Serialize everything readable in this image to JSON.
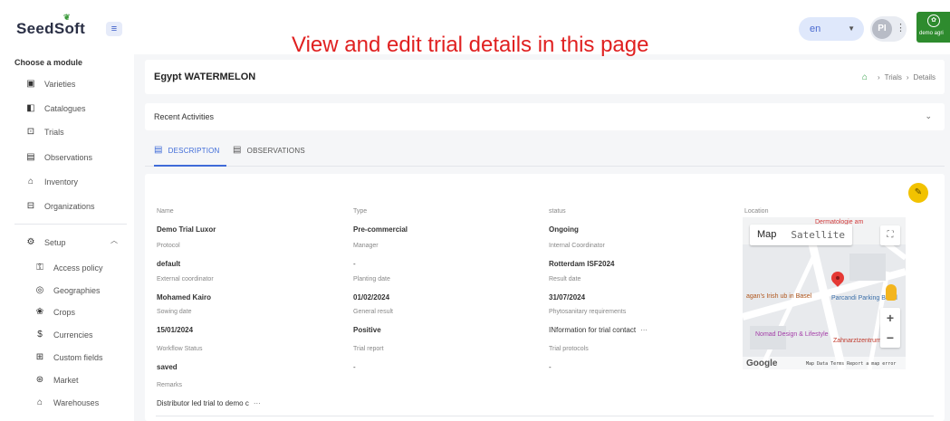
{
  "app": {
    "logo": "SeedSoft",
    "banner": "View and edit trial details in this page"
  },
  "header": {
    "language": "en",
    "avatar_initials": "PI",
    "org_name": "demo agri"
  },
  "sidebar": {
    "title": "Choose a module",
    "items": [
      {
        "label": "Varieties",
        "icon": "varieties-icon"
      },
      {
        "label": "Catalogues",
        "icon": "catalogue-icon"
      },
      {
        "label": "Trials",
        "icon": "trials-icon"
      },
      {
        "label": "Observations",
        "icon": "observations-icon"
      },
      {
        "label": "Inventory",
        "icon": "inventory-icon"
      },
      {
        "label": "Organizations",
        "icon": "organizations-icon"
      }
    ],
    "setup": {
      "label": "Setup",
      "items": [
        {
          "label": "Access policy",
          "icon": "access-policy-icon"
        },
        {
          "label": "Geographies",
          "icon": "geographies-icon"
        },
        {
          "label": "Crops",
          "icon": "crops-icon"
        },
        {
          "label": "Currencies",
          "icon": "currencies-icon"
        },
        {
          "label": "Custom fields",
          "icon": "custom-fields-icon"
        },
        {
          "label": "Market",
          "icon": "market-icon"
        },
        {
          "label": "Warehouses",
          "icon": "warehouses-icon"
        }
      ]
    }
  },
  "page": {
    "title": "Egypt WATERMELON",
    "breadcrumb": [
      "Trials",
      "Details"
    ],
    "recent_activities": "Recent Activities",
    "tabs": [
      "DESCRIPTION",
      "OBSERVATIONS"
    ]
  },
  "details": {
    "name": {
      "label": "Name",
      "value": "Demo Trial Luxor"
    },
    "type": {
      "label": "Type",
      "value": "Pre-commercial"
    },
    "status": {
      "label": "status",
      "value": "Ongoing"
    },
    "location": {
      "label": "Location"
    },
    "protocol": {
      "label": "Protocol",
      "value": "default"
    },
    "manager": {
      "label": "Manager",
      "value": "-"
    },
    "internal_coordinator": {
      "label": "Internal Coordinator",
      "value": "Rotterdam ISF2024"
    },
    "external_coordinator": {
      "label": "External coordinator",
      "value": "Mohamed Kairo"
    },
    "planting_date": {
      "label": "Planting date",
      "value": "01/02/2024"
    },
    "result_date": {
      "label": "Result date",
      "value": "31/07/2024"
    },
    "sowing_date": {
      "label": "Sowing date",
      "value": "15/01/2024"
    },
    "general_result": {
      "label": "General result",
      "value": "Positive"
    },
    "phytosanitary": {
      "label": "Phytosanitary requirements",
      "value": "INformation for trial contact"
    },
    "workflow_status": {
      "label": "Workflow Status",
      "value": "saved"
    },
    "trial_report": {
      "label": "Trial report",
      "value": "-"
    },
    "trial_protocols": {
      "label": "Trial protocols",
      "value": "-"
    },
    "remarks": {
      "label": "Remarks",
      "value": "Distributor led trial to demo c"
    },
    "more_glyph": "···"
  },
  "map": {
    "map_label": "Map",
    "satellite_label": "Satellite",
    "places": [
      "Dermatologie am",
      "Parcandi Parking Basel",
      "Zahnarztzentrum",
      "Nomad Design & Lifestyle",
      "agan's Irish ub in Basel"
    ],
    "google": "Google",
    "attribution": "Map Data  Terms  Report a map error"
  },
  "colors": {
    "accent": "#3f6bd8",
    "brand_green": "#2e8b2e",
    "edit": "#f2c200",
    "banner": "#e02020"
  }
}
